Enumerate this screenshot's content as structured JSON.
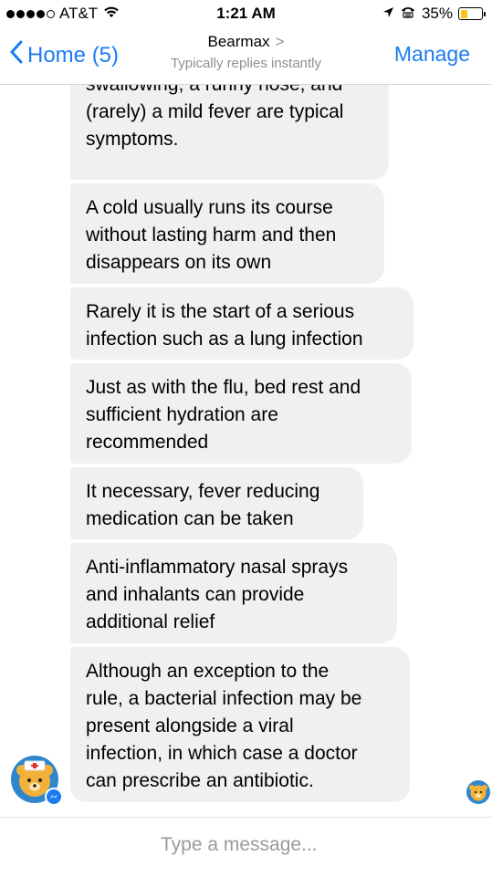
{
  "status_bar": {
    "carrier": "AT&T",
    "time": "1:21 AM",
    "battery_percent": "35%",
    "battery_level": 0.35,
    "signal_icon": "signal-dots-icon",
    "wifi_icon": "wifi-icon",
    "location_icon": "location-arrow-icon",
    "alarm_icon": "tty-icon"
  },
  "nav": {
    "back_label": "Home (5)",
    "title": "Bearmax",
    "title_chevron": ">",
    "subtitle": "Typically replies instantly",
    "manage_label": "Manage",
    "accent_color": "#1b7cf2"
  },
  "messages": [
    {
      "text": "swallowing, a runny nose, and (rarely) a mild fever are typical symptoms.",
      "lines": [
        "swallowing, a runny nose, and",
        "(rarely) a mild fever are typical",
        "symptoms."
      ]
    },
    {
      "text": "A cold usually runs its course without lasting harm and then disappears on its own",
      "lines": [
        "A cold usually runs its course",
        "without lasting harm and then",
        "disappears on its own"
      ]
    },
    {
      "text": "Rarely it is the start of a serious infection such as a lung infection",
      "lines": [
        "Rarely it is the start of a serious",
        "infection such as a lung infection"
      ]
    },
    {
      "text": "Just as with the flu, bed rest and sufficient hydration are recommended",
      "lines": [
        "Just as with the flu, bed rest and",
        "sufficient hydration are",
        "recommended"
      ]
    },
    {
      "text": "It necessary, fever reducing medication can be taken",
      "lines": [
        "It necessary, fever reducing",
        "medication can be taken"
      ]
    },
    {
      "text": "Anti-inflammatory nasal sprays and inhalants can provide additional relief",
      "lines": [
        "Anti-inflammatory nasal sprays",
        "and inhalants can provide",
        "additional relief"
      ]
    },
    {
      "text": "Although an exception to the rule, a bacterial infection may be present alongside a viral infection, in which case a doctor can prescribe an antibiotic.",
      "lines": [
        "Although an exception to the",
        "rule, a bacterial infection may be",
        "present alongside a viral",
        "infection, in which case a doctor",
        "can prescribe an antibiotic."
      ]
    }
  ],
  "bubble_color": "#f1f0f0",
  "composer": {
    "placeholder": "Type a message..."
  }
}
